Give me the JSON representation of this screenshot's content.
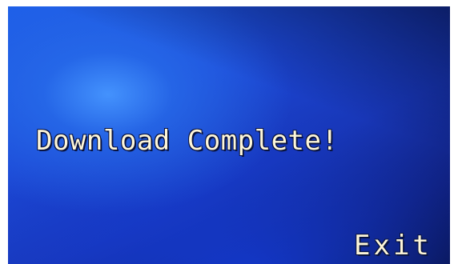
{
  "screen": {
    "message": "Download Complete!",
    "exit_label": "Exit"
  },
  "colors": {
    "text": "#fdf6d8",
    "background_light": "#4696ff",
    "background_mid": "#1c48d6",
    "background_dark": "#070d3a"
  }
}
